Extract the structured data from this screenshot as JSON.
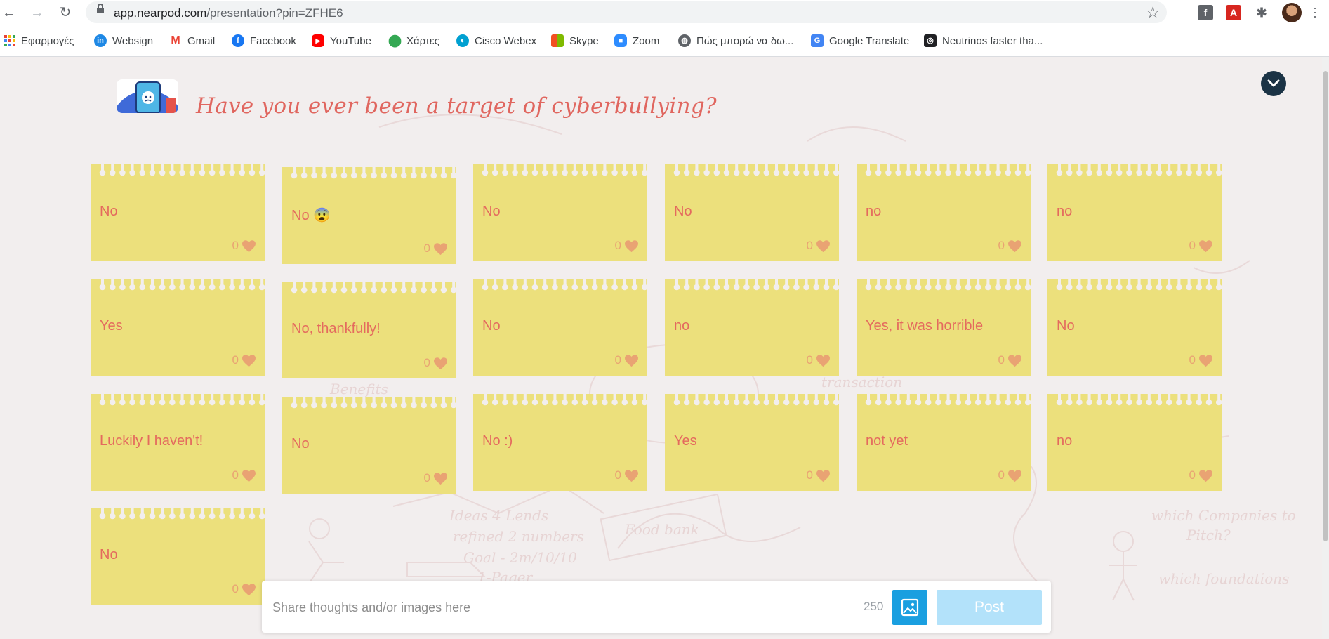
{
  "browser": {
    "url_host": "app.nearpod.com",
    "url_path": "/presentation?pin=ZFHE6",
    "bookmarks": [
      {
        "label": "Εφαρμογές",
        "icon": "apps-grid-icon"
      },
      {
        "label": "Websign",
        "icon": "websign-icon"
      },
      {
        "label": "Gmail",
        "icon": "gmail-icon"
      },
      {
        "label": "Facebook",
        "icon": "facebook-icon"
      },
      {
        "label": "YouTube",
        "icon": "youtube-icon"
      },
      {
        "label": "Χάρτες",
        "icon": "maps-icon"
      },
      {
        "label": "Cisco Webex",
        "icon": "webex-icon"
      },
      {
        "label": "Skype",
        "icon": "skype-icon"
      },
      {
        "label": "Zoom",
        "icon": "zoom-icon"
      },
      {
        "label": "Πώς μπορώ να δω...",
        "icon": "globe-icon"
      },
      {
        "label": "Google Translate",
        "icon": "translate-icon"
      },
      {
        "label": "Neutrinos faster tha...",
        "icon": "neutrinos-icon"
      }
    ]
  },
  "question": {
    "title": "Have you ever been a target of cyberbullying?"
  },
  "notes": [
    {
      "text": "No",
      "likes": "0"
    },
    {
      "text": "No 😨",
      "likes": "0"
    },
    {
      "text": "No",
      "likes": "0"
    },
    {
      "text": "No",
      "likes": "0"
    },
    {
      "text": "no",
      "likes": "0"
    },
    {
      "text": "no",
      "likes": "0"
    },
    {
      "text": "Yes",
      "likes": "0"
    },
    {
      "text": "No, thankfully!",
      "likes": "0"
    },
    {
      "text": "No",
      "likes": "0"
    },
    {
      "text": "no",
      "likes": "0"
    },
    {
      "text": "Yes, it was horrible",
      "likes": "0"
    },
    {
      "text": "No",
      "likes": "0"
    },
    {
      "text": "Luckily I haven't!",
      "likes": "0"
    },
    {
      "text": "No",
      "likes": "0"
    },
    {
      "text": "No :)",
      "likes": "0"
    },
    {
      "text": "Yes",
      "likes": "0"
    },
    {
      "text": "not yet",
      "likes": "0"
    },
    {
      "text": "no",
      "likes": "0"
    },
    {
      "text": "No",
      "likes": "0"
    }
  ],
  "composer": {
    "placeholder": "Share thoughts and/or images here",
    "char_count": "250",
    "post_label": "Post"
  },
  "colors": {
    "note": "#ece07c",
    "note_text": "#e46a5e",
    "title": "#e0665f",
    "heart": "#e9a373",
    "image_button": "#1a9fe0",
    "post_button_disabled": "#b3e2fa"
  }
}
